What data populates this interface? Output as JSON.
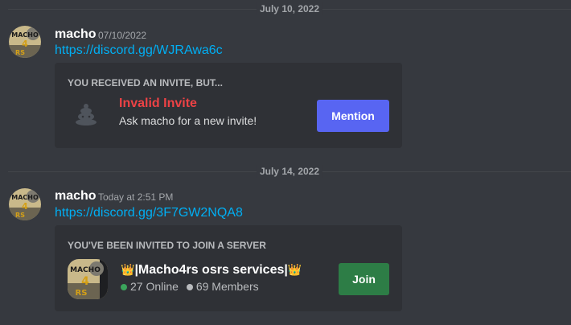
{
  "dividers": [
    {
      "label": "July 10, 2022"
    },
    {
      "label": "July 14, 2022"
    }
  ],
  "messages": [
    {
      "username": "macho",
      "timestamp": "07/10/2022",
      "link": "https://discord.gg/WJRAwa6c",
      "embed": {
        "header": "YOU RECEIVED AN INVITE, BUT...",
        "title": "Invalid Invite",
        "subtitle": "Ask macho for a new invite!",
        "button_label": "Mention",
        "icon": "sad-poop-icon"
      }
    },
    {
      "username": "macho",
      "timestamp": "Today at 2:51 PM",
      "link": "https://discord.gg/3F7GW2NQA8",
      "embed": {
        "header": "YOU'VE BEEN INVITED TO JOIN A SERVER",
        "server_name": "|Macho4rs osrs services|",
        "crown": "👑",
        "online": "27 Online",
        "members": "69 Members",
        "button_label": "Join"
      }
    }
  ],
  "avatar_text": [
    "MACHO",
    "4",
    "RS"
  ],
  "colors": {
    "background": "#36393f",
    "embed_bg": "#2f3136",
    "link": "#00aff4",
    "mention_button": "#5865f2",
    "join_button": "#2d7d46",
    "invalid_red": "#ed4245",
    "online_green": "#3ba55c",
    "members_gray": "#b9bbbe"
  }
}
